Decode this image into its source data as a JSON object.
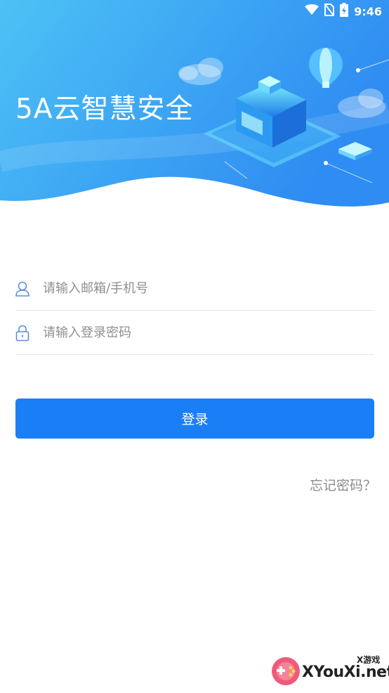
{
  "status_bar": {
    "time": "9:46",
    "icons": [
      "wifi-icon",
      "no-sim-icon",
      "battery-charging-icon"
    ]
  },
  "header": {
    "app_title": "5A云智慧安全",
    "colors": {
      "gradient_start": "#4cc2f5",
      "gradient_end": "#2f8cf2"
    }
  },
  "login_form": {
    "account": {
      "icon": "user-icon",
      "placeholder": "请输入邮箱/手机号",
      "value": ""
    },
    "password": {
      "icon": "lock-icon",
      "placeholder": "请输入登录密码",
      "value": ""
    },
    "submit_label": "登录",
    "forgot_label": "忘记密码？"
  },
  "colors": {
    "accent": "#1a7ff7",
    "divider": "#e6e6e6"
  },
  "watermark": {
    "small_text": "X游戏",
    "main_text": "XYouXi.net"
  }
}
